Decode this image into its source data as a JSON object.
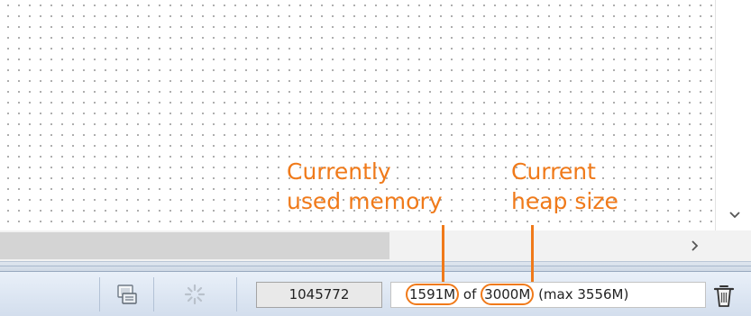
{
  "status_bar": {
    "network_icon": "network-dialog-icon",
    "spinner_icon": "activity-spinner-icon",
    "element_count": "1045772",
    "memory": {
      "used": "1591M",
      "of_text": "of",
      "heap": "3000M",
      "max_text": "(max 3556M)"
    },
    "gc_icon": "trash-can-icon"
  },
  "annotations": {
    "used_memory_line1": "Currently",
    "used_memory_line2": "used memory",
    "heap_size_line1": "Current",
    "heap_size_line2": "heap size"
  },
  "colors": {
    "annotation": "#f07a1a",
    "status_bar_top": "#e9f0f9",
    "status_bar_bottom": "#d3deed",
    "grid_dot": "#9a9a9a"
  }
}
